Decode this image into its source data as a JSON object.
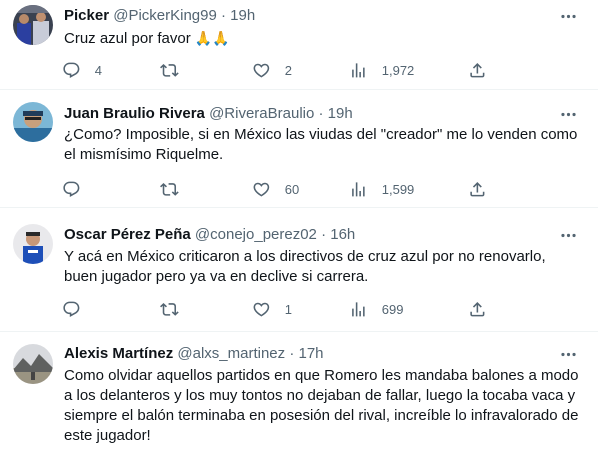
{
  "tweets": [
    {
      "name": "Picker",
      "handle": "@PickerKing99",
      "dot": "·",
      "time": "19h",
      "text": "Cruz azul por favor",
      "emoji": "🙏🙏",
      "replies": "4",
      "retweets": "",
      "likes": "2",
      "views": "1,972"
    },
    {
      "name": "Juan Braulio Rivera",
      "handle": "@RiveraBraulio",
      "dot": "·",
      "time": "19h",
      "text": "¿Como? Imposible, si en México las viudas del \"creador\" me lo venden como el mismísimo Riquelme.",
      "replies": "",
      "retweets": "",
      "likes": "60",
      "views": "1,599"
    },
    {
      "name": "Oscar Pérez Peña",
      "handle": "@conejo_perez02",
      "dot": "·",
      "time": "16h",
      "text": "Y acá en México criticaron a los directivos de cruz azul por no renovarlo, buen jugador pero ya va en declive si carrera.",
      "replies": "",
      "retweets": "",
      "likes": "1",
      "views": "699"
    },
    {
      "name": "Alexis Martínez",
      "handle": "@alxs_martinez",
      "dot": "·",
      "time": "17h",
      "text": "Como olvidar aquellos partidos en que Romero les mandaba balones a modo a los delanteros y los muy tontos no dejaban de fallar, luego la tocaba vaca y siempre el balón terminaba en posesión del rival, increíble lo infravalorado de este jugador!"
    }
  ],
  "icons": {
    "reply": "reply-icon",
    "retweet": "retweet-icon",
    "like": "heart-icon",
    "views": "views-icon",
    "share": "share-icon",
    "more": "more-icon"
  },
  "colors": {
    "text": "#0f1419",
    "secondary": "#536471",
    "divider": "#eff3f4"
  }
}
